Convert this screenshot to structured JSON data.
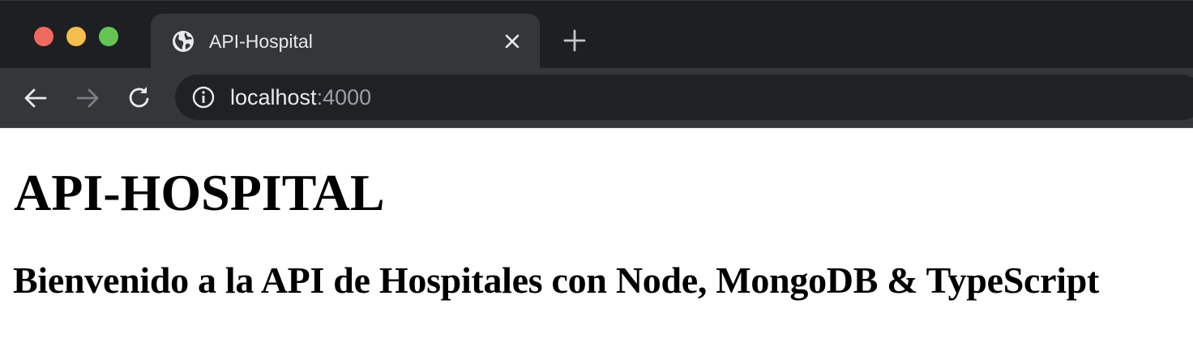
{
  "window": {
    "traffic_lights": [
      "close",
      "minimize",
      "maximize"
    ],
    "colors": {
      "close": "#ee6a5f",
      "minimize": "#f5be4f",
      "maximize": "#62c554"
    }
  },
  "tab": {
    "title": "API-Hospital",
    "favicon": "globe-icon",
    "close_icon": "close-icon"
  },
  "new_tab": {
    "icon": "plus-icon"
  },
  "toolbar": {
    "back_icon": "arrow-left-icon",
    "forward_icon": "arrow-right-icon",
    "reload_icon": "reload-icon"
  },
  "omnibox": {
    "icon": "info-icon",
    "host": "localhost",
    "port": ":4000"
  },
  "page": {
    "heading": "API-HOSPITAL",
    "subheading": "Bienvenido a la API de Hospitales con Node, MongoDB & TypeScript"
  }
}
